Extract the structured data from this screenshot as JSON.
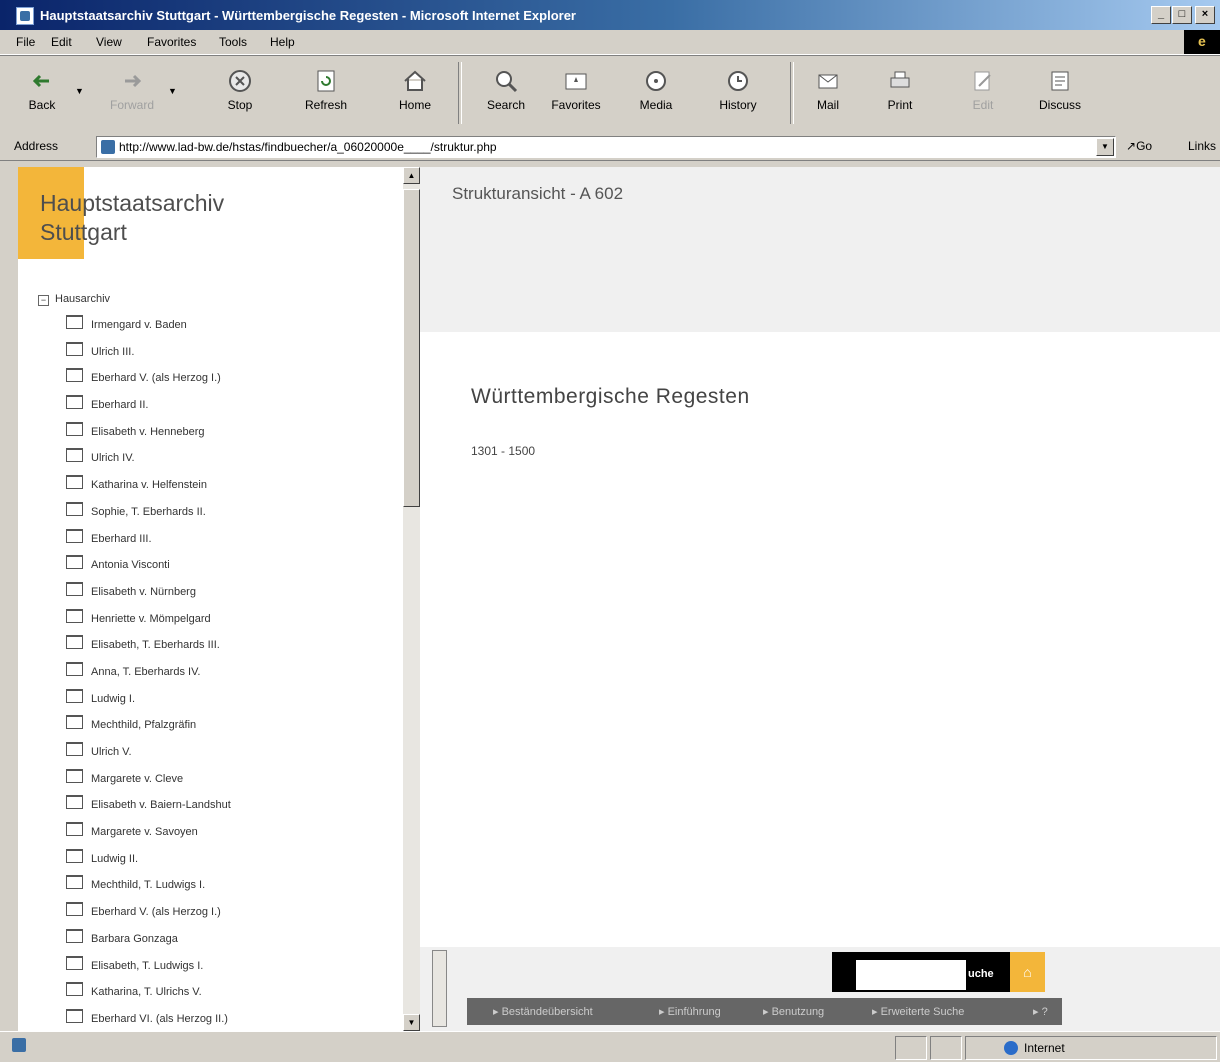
{
  "window": {
    "title": "Hauptstaatsarchiv Stuttgart - Württembergische Regesten - Microsoft Internet Explorer"
  },
  "menu": [
    "File",
    "Edit",
    "View",
    "Favorites",
    "Tools",
    "Help"
  ],
  "toolbar": {
    "back": "Back",
    "forward": "Forward",
    "stop": "Stop",
    "refresh": "Refresh",
    "home": "Home",
    "search": "Search",
    "favorites": "Favorites",
    "media": "Media",
    "history": "History",
    "mail": "Mail",
    "print": "Print",
    "edit": "Edit",
    "discuss": "Discuss"
  },
  "address": {
    "label": "Address",
    "url": "http://www.lad-bw.de/hstas/findbuecher/a_06020000e____/struktur.php",
    "go": "Go",
    "links": "Links"
  },
  "left": {
    "archive_title": "Hauptstaatsarchiv\nStuttgart",
    "tree_root": "Hausarchiv",
    "tree_items": [
      "Irmengard v. Baden",
      "Ulrich III.",
      "Eberhard V. (als Herzog I.)",
      "Eberhard II.",
      "Elisabeth v. Henneberg",
      "Ulrich IV.",
      "Katharina v. Helfenstein",
      "Sophie, T. Eberhards II.",
      "Eberhard III.",
      "Antonia Visconti",
      "Elisabeth v. Nürnberg",
      "Henriette v. Mömpelgard",
      "Elisabeth, T. Eberhards III.",
      "Anna, T. Eberhards IV.",
      "Ludwig I.",
      "Mechthild, Pfalzgräfin",
      "Ulrich V.",
      "Margarete v. Cleve",
      "Elisabeth v. Baiern-Landshut",
      "Margarete v. Savoyen",
      "Ludwig II.",
      "Mechthild, T. Ludwigs I.",
      "Eberhard V. (als Herzog I.)",
      "Barbara Gonzaga",
      "Elisabeth, T. Ludwigs I.",
      "Katharina, T. Ulrichs V.",
      "Eberhard VI. (als Herzog II.)"
    ]
  },
  "right": {
    "struct_view": "Strukturansicht - A 602",
    "title": "Württembergische Regesten",
    "date_range": "1301 - 1500",
    "search_label": "uche",
    "home_icon": "⌂",
    "nav": {
      "bestand": "▸ Beständeübersicht",
      "einfuehrung": "▸ Einführung",
      "benutzung": "▸ Benutzung",
      "erweitert": "▸ Erweiterte Suche",
      "more": "▸ ?"
    }
  },
  "status": {
    "zone": "Internet"
  },
  "colors": {
    "accent": "#f3b63a",
    "titlebar": "#0a246a",
    "nav_bar": "#666666"
  }
}
